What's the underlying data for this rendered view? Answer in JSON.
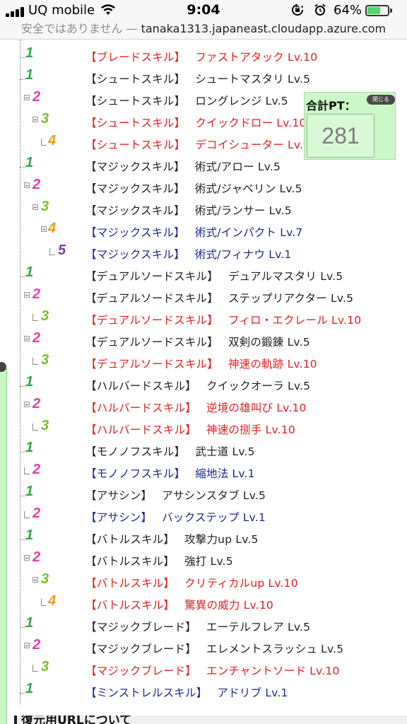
{
  "status_bar": {
    "carrier": "UQ mobile",
    "time": "9:04",
    "battery_percent": "64%",
    "battery_level": 0.64,
    "icons": [
      "signal-icon",
      "wifi-icon",
      "screen-rotation-lock-icon",
      "alarm-icon",
      "battery-icon"
    ]
  },
  "url_bar": {
    "warning": "安全ではありません",
    "separator": " — ",
    "host": "tanaka1313.japaneast.cloudapp.azure.com"
  },
  "skill_tree": [
    {
      "level": "1",
      "category": "【ブレードスキル】",
      "name": "ファストアタック Lv.10",
      "color": "red"
    },
    {
      "level": "1",
      "category": "【シュートスキル】",
      "name": "シュートマスタリ Lv.5",
      "color": "black"
    },
    {
      "level": "2",
      "category": "【シュートスキル】",
      "name": "ロングレンジ Lv.5",
      "color": "black"
    },
    {
      "level": "3",
      "category": "【シュートスキル】",
      "name": "クイックドロー Lv.10",
      "color": "red"
    },
    {
      "level": "4",
      "category": "【シュートスキル】",
      "name": "デコイシューター Lv.10",
      "color": "red"
    },
    {
      "level": "1",
      "category": "【マジックスキル】",
      "name": "術式/アロー Lv.5",
      "color": "black"
    },
    {
      "level": "2",
      "category": "【マジックスキル】",
      "name": "術式/ジャベリン Lv.5",
      "color": "black"
    },
    {
      "level": "3",
      "category": "【マジックスキル】",
      "name": "術式/ランサー Lv.5",
      "color": "black"
    },
    {
      "level": "4",
      "category": "【マジックスキル】",
      "name": "術式/インパクト Lv.7",
      "color": "blue"
    },
    {
      "level": "5",
      "category": "【マジックスキル】",
      "name": "術式/フィナウ Lv.1",
      "color": "blue"
    },
    {
      "level": "1",
      "category": "【デュアルソードスキル】",
      "name": "デュアルマスタリ Lv.5",
      "color": "black"
    },
    {
      "level": "2",
      "category": "【デュアルソードスキル】",
      "name": "ステップリアクター Lv.5",
      "color": "black"
    },
    {
      "level": "3",
      "category": "【デュアルソードスキル】",
      "name": "フィロ・エクレール Lv.10",
      "color": "red"
    },
    {
      "level": "2",
      "category": "【デュアルソードスキル】",
      "name": "双剣の鍛錬 Lv.5",
      "color": "black"
    },
    {
      "level": "3",
      "category": "【デュアルソードスキル】",
      "name": "神速の軌跡 Lv.10",
      "color": "red"
    },
    {
      "level": "1",
      "category": "【ハルバードスキル】",
      "name": "クイックオーラ Lv.5",
      "color": "black"
    },
    {
      "level": "2",
      "category": "【ハルバードスキル】",
      "name": "逆境の雄叫び Lv.10",
      "color": "red"
    },
    {
      "level": "3",
      "category": "【ハルバードスキル】",
      "name": "神速の捌手 Lv.10",
      "color": "red"
    },
    {
      "level": "1",
      "category": "【モノノフスキル】",
      "name": "武士道 Lv.5",
      "color": "black"
    },
    {
      "level": "2",
      "category": "【モノノフスキル】",
      "name": "縮地法 Lv.1",
      "color": "blue"
    },
    {
      "level": "1",
      "category": "【アサシン】",
      "name": "アサシンスタブ Lv.5",
      "color": "black"
    },
    {
      "level": "2",
      "category": "【アサシン】",
      "name": "バックステップ Lv.1",
      "color": "blue"
    },
    {
      "level": "1",
      "category": "【バトルスキル】",
      "name": "攻撃力up Lv.5",
      "color": "black"
    },
    {
      "level": "2",
      "category": "【バトルスキル】",
      "name": "強打 Lv.5",
      "color": "black"
    },
    {
      "level": "3",
      "category": "【バトルスキル】",
      "name": "クリティカルup Lv.10",
      "color": "red"
    },
    {
      "level": "4",
      "category": "【バトルスキル】",
      "name": "驚異の威力 Lv.10",
      "color": "red"
    },
    {
      "level": "1",
      "category": "【マジックブレード】",
      "name": "エーテルフレア Lv.5",
      "color": "black"
    },
    {
      "level": "2",
      "category": "【マジックブレード】",
      "name": "エレメントスラッシュ Lv.5",
      "color": "black"
    },
    {
      "level": "3",
      "category": "【マジックブレード】",
      "name": "エンチャントソード Lv.10",
      "color": "red"
    },
    {
      "level": "1",
      "category": "【ミンストレルスキル】",
      "name": "アドリブ Lv.1",
      "color": "blue"
    }
  ],
  "level_colors": {
    "1": "#2fa84a",
    "2": "#e23fa3",
    "3": "#7fbf2a",
    "4": "#f29a1c",
    "5": "#7a3fa0"
  },
  "text_colors": {
    "red": "#e41e1e",
    "blue": "#1c2a8c",
    "black": "#222222"
  },
  "points_panel": {
    "label": "合計PT：",
    "close_label": "閉じる",
    "value": "281"
  },
  "bottom_heading": "復元用URLについて"
}
